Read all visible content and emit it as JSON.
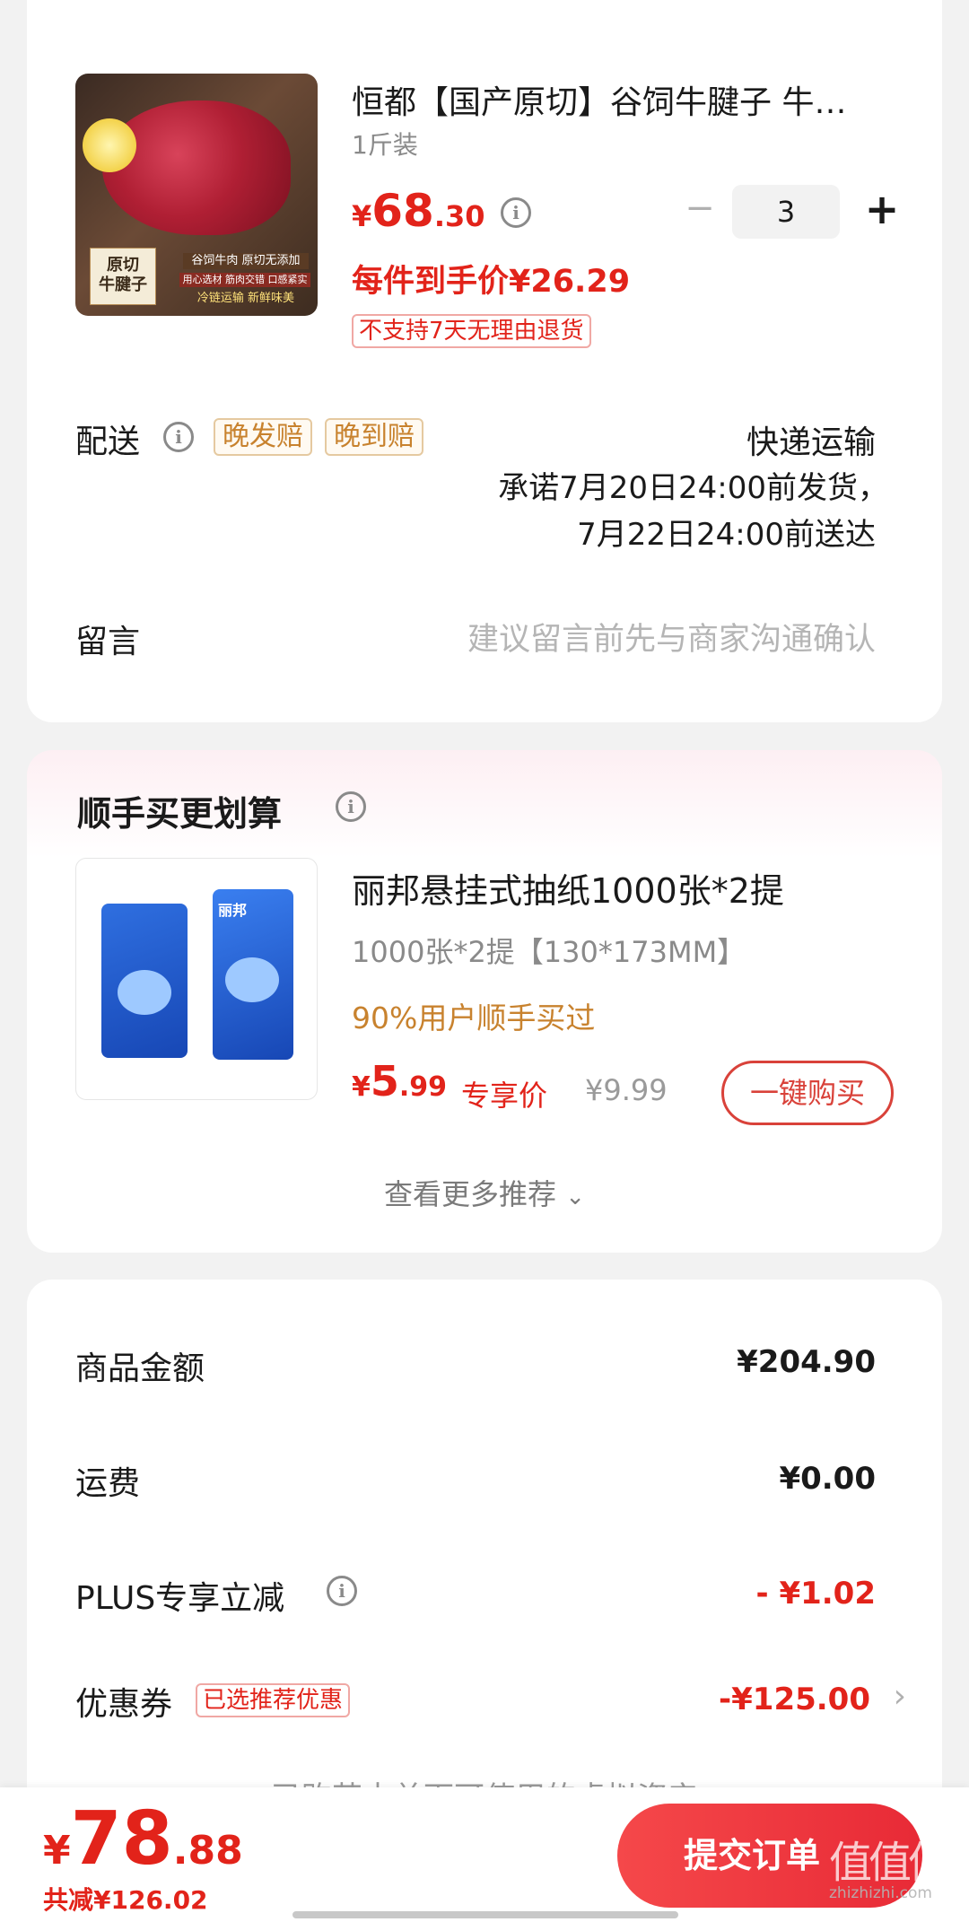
{
  "product": {
    "title": "恒都【国产原切】谷饲牛腱子  牛…",
    "spec": "1斤装",
    "image_caption_left": "原切\n牛腱子",
    "image_caption_right_1": "谷饲牛肉 原切无添加",
    "image_caption_right_2": "用心选材 筋肉交错 口感紧实",
    "image_caption_right_3": "冷链运输 新鲜味美",
    "price_symbol": "¥",
    "price_int": "68",
    "price_dec": ".30",
    "unit_price": "每件到手价¥26.29",
    "quantity": "3",
    "minus": "−",
    "plus": "+",
    "return_policy": "不支持7天无理由退货"
  },
  "delivery": {
    "label": "配送",
    "tag1": "晚发赔",
    "tag2": "晚到赔",
    "method": "快递运输",
    "promise_line1": "承诺7月20日24:00前发货，",
    "promise_line2": "7月22日24:00前送达"
  },
  "message": {
    "label": "留言",
    "placeholder": "建议留言前先与商家沟通确认"
  },
  "upsell": {
    "heading": "顺手买更划算",
    "brand_on_pack": "丽邦",
    "title": "丽邦悬挂式抽纸1000张*2提",
    "spec": "1000张*2提【130*173MM】",
    "social_proof": "90%用户顺手买过",
    "price_symbol": "¥",
    "price_int": "5",
    "price_dec": ".99",
    "price_tag": "专享价",
    "original_price": "¥9.99",
    "buy_button": "一键购买",
    "more": "查看更多推荐"
  },
  "summary": {
    "goods_label": "商品金额",
    "goods_value": "¥204.90",
    "shipping_label": "运费",
    "shipping_value": "¥0.00",
    "plus_label": "PLUS专享立减",
    "plus_value": "- ¥1.02",
    "coupon_label": "优惠券",
    "coupon_tag": "已选推荐优惠",
    "coupon_value": "-¥125.00",
    "partial_text": "已购芸本单下可使用的虚拟资产"
  },
  "footer": {
    "total_symbol": "¥",
    "total_int": "78",
    "total_dec": ".88",
    "saved": "共减¥126.02",
    "submit": "提交订单",
    "watermark_big": "值值值",
    "watermark_small": "zhizhizhi.com"
  },
  "colors": {
    "accent_red": "#e2231a",
    "button_red": "#f03d3d",
    "tag_gold": "#c8822e",
    "background": "#f2f2f2"
  }
}
